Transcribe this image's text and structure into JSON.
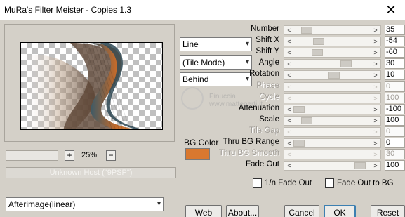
{
  "window": {
    "title": "MuRa's Filter Meister - Copies 1.3",
    "close_glyph": "✕"
  },
  "preview": {
    "zoom_minus": "−",
    "zoom_plus": "+",
    "zoom_value": "25%",
    "host_status": "Unknown Host (\"9PSP\")"
  },
  "controls": {
    "mode": "Line",
    "tile_mode": "(Tile Mode)",
    "order": "Behind",
    "blend": "Afterimage(linear)",
    "bg_color_label": "BG Color",
    "bg_color": "#d9782f"
  },
  "params": [
    {
      "label": "Number",
      "value": "35",
      "enabled": true,
      "fraction": 0.12
    },
    {
      "label": "Shift X",
      "value": "-54",
      "enabled": true,
      "fraction": 0.29
    },
    {
      "label": "Shift Y",
      "value": "-60",
      "enabled": true,
      "fraction": 0.27
    },
    {
      "label": "Angle",
      "value": "30",
      "enabled": true,
      "fraction": 0.71
    },
    {
      "label": "Rotation",
      "value": "10",
      "enabled": true,
      "fraction": 0.53
    },
    {
      "label": "Phase",
      "value": "0",
      "enabled": false,
      "fraction": 0.0
    },
    {
      "label": "Cycle",
      "value": "100",
      "enabled": false,
      "fraction": 0.0
    },
    {
      "label": "Attenuation",
      "value": "-100",
      "enabled": true,
      "fraction": 0.0
    },
    {
      "label": "Scale",
      "value": "100",
      "enabled": true,
      "fraction": 0.12
    },
    {
      "label": "Tile Gap",
      "value": "0",
      "enabled": false,
      "fraction": 0.0
    },
    {
      "label": "Thru BG Range",
      "value": "0",
      "enabled": true,
      "fraction": 0.0
    },
    {
      "label": "Thru BG Smooth",
      "value": "30",
      "enabled": false,
      "fraction": 0.0
    },
    {
      "label": "Fade Out",
      "value": "100",
      "enabled": true,
      "fraction": 0.92
    }
  ],
  "checkboxes": {
    "fade_1n": "1/n Fade Out",
    "fade_to_bg": "Fade Out to BG"
  },
  "buttons": {
    "web": "Web",
    "about": "About...",
    "cancel": "Cancel",
    "ok": "OK",
    "reset": "Reset"
  },
  "icons": {
    "left_arrow": "<",
    "right_arrow": ">",
    "dropdown": "▾"
  },
  "watermark": {
    "line1": "Pinuccia",
    "line2": "www.matteperti.it"
  }
}
